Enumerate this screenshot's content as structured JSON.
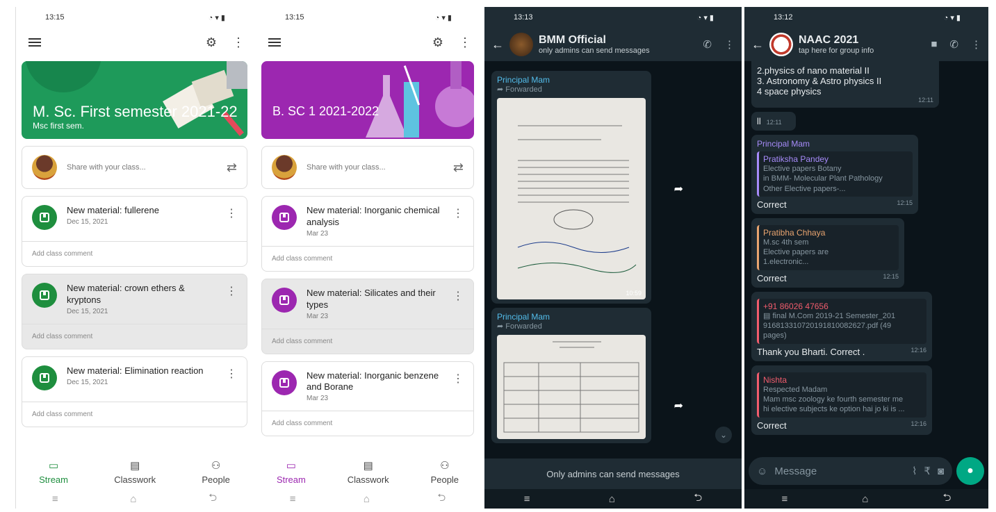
{
  "panel1": {
    "status_time": "13:15",
    "banner_title": "M. Sc. First semester 2021-22",
    "banner_subtitle": "Msc first sem.",
    "share_placeholder": "Share with your class...",
    "posts": [
      {
        "title": "New material: fullerene",
        "date": "Dec 15, 2021",
        "comment": "Add class comment"
      },
      {
        "title": "New material: crown ethers & kryptons",
        "date": "Dec 15, 2021",
        "comment": "Add class comment"
      },
      {
        "title": "New material: Elimination reaction",
        "date": "Dec 15, 2021",
        "comment": "Add class comment"
      }
    ],
    "nav": {
      "stream": "Stream",
      "classwork": "Classwork",
      "people": "People"
    }
  },
  "panel2": {
    "status_time": "13:15",
    "banner_title": "B. SC 1 2021-2022",
    "share_placeholder": "Share with your class...",
    "posts": [
      {
        "title": "New material: Inorganic chemical analysis",
        "date": "Mar 23",
        "comment": "Add class comment"
      },
      {
        "title": "New material: Silicates and their types",
        "date": "Mar 23",
        "comment": "Add class comment"
      },
      {
        "title": "New material: Inorganic benzene and Borane",
        "date": "Mar 23",
        "comment": "Add class comment"
      }
    ],
    "nav": {
      "stream": "Stream",
      "classwork": "Classwork",
      "people": "People"
    }
  },
  "panel3": {
    "status_time": "13:13",
    "chat_name": "BMM Official",
    "chat_subtitle": "only admins can send messages",
    "messages": [
      {
        "sender": "Principal Mam",
        "forwarded": "Forwarded",
        "time": "10:59"
      },
      {
        "sender": "Principal Mam",
        "forwarded": "Forwarded"
      }
    ],
    "footer": "Only admins can send messages"
  },
  "panel4": {
    "status_time": "13:12",
    "chat_name": "NAAC 2021",
    "chat_subtitle": "tap here for group info",
    "first_bubble": {
      "lines": [
        "2.physics of nano material II",
        "3. Astronomy & Astro physics II",
        "4 space physics"
      ],
      "time": "12:11"
    },
    "second_bubble": {
      "text": "ll",
      "time": "12:11"
    },
    "replies": [
      {
        "sender": "Principal Mam",
        "quote_name": "Pratiksha Pandey",
        "quote_lines": [
          "Elective papers Botany",
          "in BMM- Molecular Plant Pathology",
          "Other Elective papers-..."
        ],
        "text": "Correct",
        "time": "12:15",
        "quote_color": "#a78bfa"
      },
      {
        "quote_name": "Pratibha Chhaya",
        "quote_lines": [
          "M.sc 4th sem",
          "Elective papers are",
          "1.electronic..."
        ],
        "text": "Correct",
        "time": "12:15",
        "quote_color": "#e8a46f"
      },
      {
        "quote_name": "+91 86026 47656",
        "quote_lines": [
          "final M.Com 2019-21 Semester_201",
          "916813310720191810082627.pdf (49",
          "pages)"
        ],
        "text": "Thank you Bharti. Correct .",
        "time": "12:16",
        "quote_color": "#f15c6d"
      },
      {
        "quote_name": "Nishta",
        "quote_lines": [
          "Respected Madam",
          "Mam msc zoology ke fourth semester me",
          "hi elective subjects ke option hai jo ki is ..."
        ],
        "text": "Correct",
        "time": "12:16",
        "quote_color": "#f15c6d"
      }
    ],
    "composer_placeholder": "Message"
  }
}
